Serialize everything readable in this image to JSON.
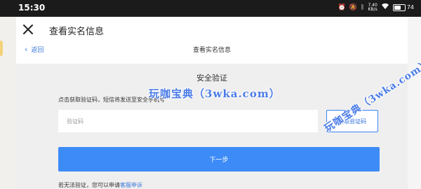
{
  "status_bar": {
    "time": "15:30",
    "net_speed": "7.40\nKB/s",
    "battery": "74"
  },
  "app_bar": {
    "title": "查看实名信息"
  },
  "web_nav": {
    "back_label": "返回",
    "title": "查看实名信息"
  },
  "verification": {
    "section_title": "安全验证",
    "instruction": "点击获取验证码，短信将发送至安全手机号",
    "code_placeholder": "验证码",
    "get_code_label": "获取验证码",
    "next_label": "下一步",
    "appeal_text": "若无法验证，您可以申请",
    "appeal_link": "客服申诉"
  },
  "watermark": {
    "text_1": "玩咖宝典（3wka.com）",
    "text_2": "玩咖宝典（3wka.com）"
  },
  "colors": {
    "accent": "#3d8bf7",
    "link": "#3b78d8",
    "status_bar": "#1b1b1b"
  }
}
